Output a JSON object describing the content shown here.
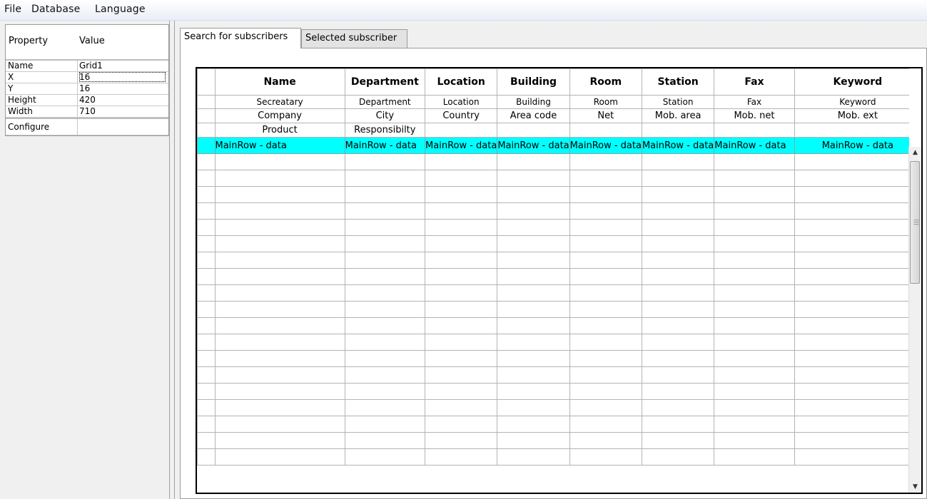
{
  "menu": [
    "File",
    "Database",
    "Language"
  ],
  "properties": {
    "header": {
      "property": "Property",
      "value": "Value"
    },
    "rows": [
      {
        "key": "Name",
        "value": "Grid1"
      },
      {
        "key": "X",
        "value": "16"
      },
      {
        "key": "Y",
        "value": "16"
      },
      {
        "key": "Height",
        "value": "420"
      },
      {
        "key": "Width",
        "value": "710"
      },
      {
        "key": "Configure",
        "value": ""
      }
    ]
  },
  "tabs": [
    {
      "label": "Search for subscribers",
      "active": true
    },
    {
      "label": "Selected subscriber",
      "active": false
    }
  ],
  "grid": {
    "header": [
      "Name",
      "Department",
      "Location",
      "Building",
      "Room",
      "Station",
      "Fax",
      "Keyword"
    ],
    "subheader1": [
      "Secreatary",
      "Department",
      "Location",
      "Building",
      "Room",
      "Station",
      "Fax",
      "Keyword"
    ],
    "subheader2": [
      "Company",
      "City",
      "Country",
      "Area code",
      "Net",
      "Mob. area",
      "Mob. net",
      "Mob. ext"
    ],
    "subheader3": [
      "Product",
      "Responsibilty",
      "",
      "",
      "",
      "",
      "",
      ""
    ],
    "data_row": [
      "MainRow - data",
      "MainRow - data",
      "MainRow - data",
      "MainRow - data",
      "MainRow - data",
      "MainRow - data",
      "MainRow - data",
      "MainRow - data"
    ],
    "highlight_color": "#00ffff"
  }
}
